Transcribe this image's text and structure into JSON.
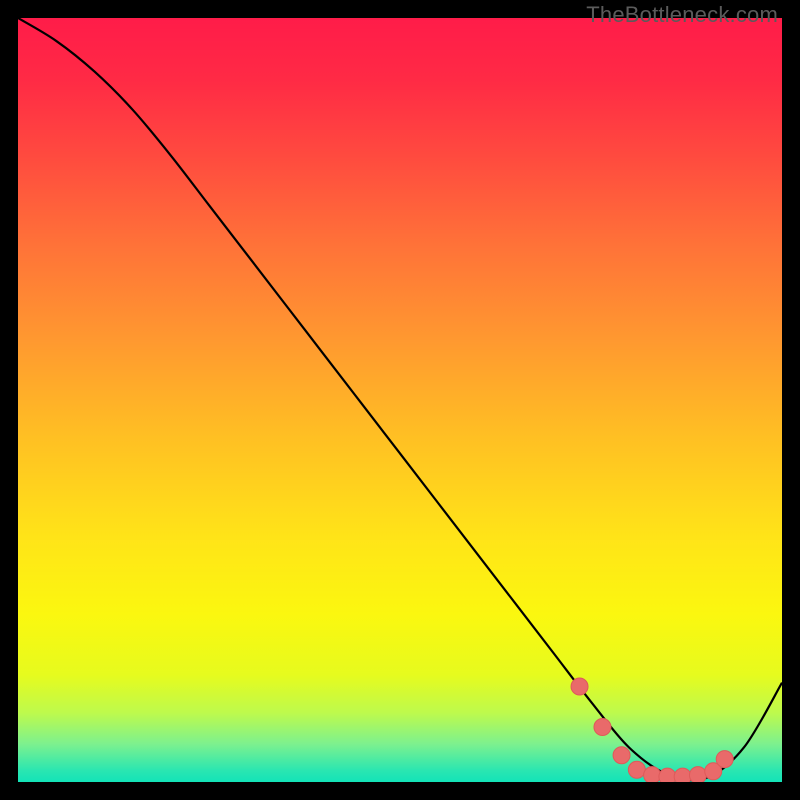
{
  "watermark": "TheBottleneck.com",
  "chart_data": {
    "type": "line",
    "title": "",
    "xlabel": "",
    "ylabel": "",
    "x_range": [
      0,
      100
    ],
    "y_range": [
      0,
      100
    ],
    "series": [
      {
        "name": "curve",
        "x": [
          0,
          5,
          10,
          15,
          20,
          25,
          30,
          35,
          40,
          45,
          50,
          55,
          60,
          65,
          70,
          75,
          80,
          85,
          90,
          95,
          100
        ],
        "values": [
          100,
          97,
          93,
          88,
          82,
          75.5,
          69,
          62.5,
          56,
          49.5,
          43,
          36.5,
          30,
          23.5,
          17,
          10.5,
          4.5,
          1.0,
          0.5,
          4.5,
          13
        ]
      }
    ],
    "markers": {
      "name": "highlight-points",
      "x": [
        73.5,
        76.5,
        79,
        81,
        83,
        85,
        87,
        89,
        91,
        92.5
      ],
      "values": [
        12.5,
        7.2,
        3.5,
        1.6,
        0.9,
        0.7,
        0.7,
        0.9,
        1.4,
        3.0
      ]
    },
    "colors": {
      "curve": "#000000",
      "marker_fill": "#e96a6a",
      "marker_stroke": "#de5a5a"
    },
    "background_gradient": {
      "stops": [
        {
          "offset": 0.0,
          "color": "#ff1c49"
        },
        {
          "offset": 0.08,
          "color": "#ff2a45"
        },
        {
          "offset": 0.18,
          "color": "#ff4a3f"
        },
        {
          "offset": 0.3,
          "color": "#ff7338"
        },
        {
          "offset": 0.42,
          "color": "#ff9830"
        },
        {
          "offset": 0.55,
          "color": "#ffc023"
        },
        {
          "offset": 0.68,
          "color": "#ffe418"
        },
        {
          "offset": 0.78,
          "color": "#fbf70f"
        },
        {
          "offset": 0.86,
          "color": "#e6fb1e"
        },
        {
          "offset": 0.91,
          "color": "#bdfa4d"
        },
        {
          "offset": 0.95,
          "color": "#7df18e"
        },
        {
          "offset": 0.985,
          "color": "#2ae6b1"
        },
        {
          "offset": 1.0,
          "color": "#13e3b8"
        }
      ]
    }
  }
}
